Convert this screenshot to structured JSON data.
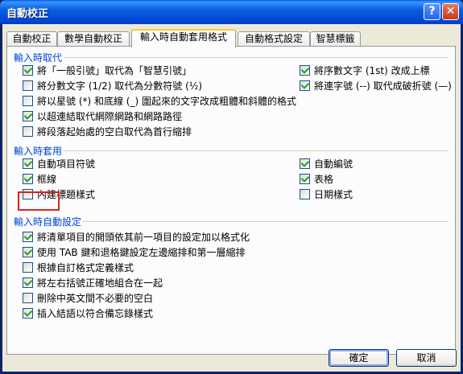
{
  "window": {
    "title": "自動校正",
    "help_glyph": "?",
    "close_glyph": "✕"
  },
  "tabs": [
    {
      "label": "自動校正"
    },
    {
      "label": "數學自動校正"
    },
    {
      "label": "輸入時自動套用格式"
    },
    {
      "label": "自動格式設定"
    },
    {
      "label": "智慧標籤"
    }
  ],
  "groups": {
    "replace": {
      "title": "輸入時取代",
      "options": [
        {
          "label": "將「一般引號」取代為「智慧引號」",
          "checked": true
        },
        {
          "label": "將分數文字 (1/2) 取代為分數符號 (½)",
          "checked": false
        },
        {
          "label": "將以星號 (*) 和底線 (_) 圍起來的文字改成粗體和斜體的格式",
          "checked": false
        },
        {
          "label": "以超連結取代網際網路和網路路徑",
          "checked": true
        },
        {
          "label": "將段落起始處的空白取代為首行縮排",
          "checked": false
        },
        {
          "label": "將序數文字 (1st) 改成上標",
          "checked": true
        },
        {
          "label": "將連字號 (--) 取代成破折號 (—)",
          "checked": true
        }
      ]
    },
    "apply": {
      "title": "輸入時套用",
      "options": [
        {
          "label": "自動項目符號",
          "checked": true
        },
        {
          "label": "框線",
          "checked": true
        },
        {
          "label": "內建標題樣式",
          "checked": false
        },
        {
          "label": "自動編號",
          "checked": true
        },
        {
          "label": "表格",
          "checked": true
        },
        {
          "label": "日期樣式",
          "checked": false
        }
      ]
    },
    "auto": {
      "title": "輸入時自動設定",
      "options": [
        {
          "label": "將清單項目的開頭依其前一項目的設定加以格式化",
          "checked": true
        },
        {
          "label": "使用 TAB 鍵和退格鍵設定左邊縮排和第一層縮排",
          "checked": true
        },
        {
          "label": "根據自訂格式定義樣式",
          "checked": false
        },
        {
          "label": "將左右括號正確地組合在一起",
          "checked": true
        },
        {
          "label": "刪除中英文間不必要的空白",
          "checked": false
        },
        {
          "label": "插入結語以符合備忘錄樣式",
          "checked": true
        }
      ]
    }
  },
  "buttons": {
    "ok": "確定",
    "cancel": "取消"
  }
}
